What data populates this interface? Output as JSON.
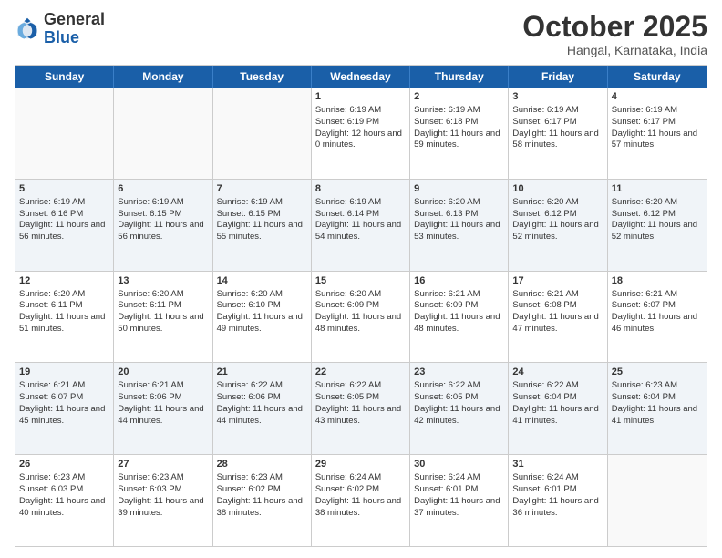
{
  "header": {
    "logo_general": "General",
    "logo_blue": "Blue",
    "month_title": "October 2025",
    "location": "Hangal, Karnataka, India"
  },
  "weekdays": [
    "Sunday",
    "Monday",
    "Tuesday",
    "Wednesday",
    "Thursday",
    "Friday",
    "Saturday"
  ],
  "rows": [
    [
      {
        "day": "",
        "sunrise": "",
        "sunset": "",
        "daylight": ""
      },
      {
        "day": "",
        "sunrise": "",
        "sunset": "",
        "daylight": ""
      },
      {
        "day": "",
        "sunrise": "",
        "sunset": "",
        "daylight": ""
      },
      {
        "day": "1",
        "sunrise": "Sunrise: 6:19 AM",
        "sunset": "Sunset: 6:19 PM",
        "daylight": "Daylight: 12 hours and 0 minutes."
      },
      {
        "day": "2",
        "sunrise": "Sunrise: 6:19 AM",
        "sunset": "Sunset: 6:18 PM",
        "daylight": "Daylight: 11 hours and 59 minutes."
      },
      {
        "day": "3",
        "sunrise": "Sunrise: 6:19 AM",
        "sunset": "Sunset: 6:17 PM",
        "daylight": "Daylight: 11 hours and 58 minutes."
      },
      {
        "day": "4",
        "sunrise": "Sunrise: 6:19 AM",
        "sunset": "Sunset: 6:17 PM",
        "daylight": "Daylight: 11 hours and 57 minutes."
      }
    ],
    [
      {
        "day": "5",
        "sunrise": "Sunrise: 6:19 AM",
        "sunset": "Sunset: 6:16 PM",
        "daylight": "Daylight: 11 hours and 56 minutes."
      },
      {
        "day": "6",
        "sunrise": "Sunrise: 6:19 AM",
        "sunset": "Sunset: 6:15 PM",
        "daylight": "Daylight: 11 hours and 56 minutes."
      },
      {
        "day": "7",
        "sunrise": "Sunrise: 6:19 AM",
        "sunset": "Sunset: 6:15 PM",
        "daylight": "Daylight: 11 hours and 55 minutes."
      },
      {
        "day": "8",
        "sunrise": "Sunrise: 6:19 AM",
        "sunset": "Sunset: 6:14 PM",
        "daylight": "Daylight: 11 hours and 54 minutes."
      },
      {
        "day": "9",
        "sunrise": "Sunrise: 6:20 AM",
        "sunset": "Sunset: 6:13 PM",
        "daylight": "Daylight: 11 hours and 53 minutes."
      },
      {
        "day": "10",
        "sunrise": "Sunrise: 6:20 AM",
        "sunset": "Sunset: 6:12 PM",
        "daylight": "Daylight: 11 hours and 52 minutes."
      },
      {
        "day": "11",
        "sunrise": "Sunrise: 6:20 AM",
        "sunset": "Sunset: 6:12 PM",
        "daylight": "Daylight: 11 hours and 52 minutes."
      }
    ],
    [
      {
        "day": "12",
        "sunrise": "Sunrise: 6:20 AM",
        "sunset": "Sunset: 6:11 PM",
        "daylight": "Daylight: 11 hours and 51 minutes."
      },
      {
        "day": "13",
        "sunrise": "Sunrise: 6:20 AM",
        "sunset": "Sunset: 6:11 PM",
        "daylight": "Daylight: 11 hours and 50 minutes."
      },
      {
        "day": "14",
        "sunrise": "Sunrise: 6:20 AM",
        "sunset": "Sunset: 6:10 PM",
        "daylight": "Daylight: 11 hours and 49 minutes."
      },
      {
        "day": "15",
        "sunrise": "Sunrise: 6:20 AM",
        "sunset": "Sunset: 6:09 PM",
        "daylight": "Daylight: 11 hours and 48 minutes."
      },
      {
        "day": "16",
        "sunrise": "Sunrise: 6:21 AM",
        "sunset": "Sunset: 6:09 PM",
        "daylight": "Daylight: 11 hours and 48 minutes."
      },
      {
        "day": "17",
        "sunrise": "Sunrise: 6:21 AM",
        "sunset": "Sunset: 6:08 PM",
        "daylight": "Daylight: 11 hours and 47 minutes."
      },
      {
        "day": "18",
        "sunrise": "Sunrise: 6:21 AM",
        "sunset": "Sunset: 6:07 PM",
        "daylight": "Daylight: 11 hours and 46 minutes."
      }
    ],
    [
      {
        "day": "19",
        "sunrise": "Sunrise: 6:21 AM",
        "sunset": "Sunset: 6:07 PM",
        "daylight": "Daylight: 11 hours and 45 minutes."
      },
      {
        "day": "20",
        "sunrise": "Sunrise: 6:21 AM",
        "sunset": "Sunset: 6:06 PM",
        "daylight": "Daylight: 11 hours and 44 minutes."
      },
      {
        "day": "21",
        "sunrise": "Sunrise: 6:22 AM",
        "sunset": "Sunset: 6:06 PM",
        "daylight": "Daylight: 11 hours and 44 minutes."
      },
      {
        "day": "22",
        "sunrise": "Sunrise: 6:22 AM",
        "sunset": "Sunset: 6:05 PM",
        "daylight": "Daylight: 11 hours and 43 minutes."
      },
      {
        "day": "23",
        "sunrise": "Sunrise: 6:22 AM",
        "sunset": "Sunset: 6:05 PM",
        "daylight": "Daylight: 11 hours and 42 minutes."
      },
      {
        "day": "24",
        "sunrise": "Sunrise: 6:22 AM",
        "sunset": "Sunset: 6:04 PM",
        "daylight": "Daylight: 11 hours and 41 minutes."
      },
      {
        "day": "25",
        "sunrise": "Sunrise: 6:23 AM",
        "sunset": "Sunset: 6:04 PM",
        "daylight": "Daylight: 11 hours and 41 minutes."
      }
    ],
    [
      {
        "day": "26",
        "sunrise": "Sunrise: 6:23 AM",
        "sunset": "Sunset: 6:03 PM",
        "daylight": "Daylight: 11 hours and 40 minutes."
      },
      {
        "day": "27",
        "sunrise": "Sunrise: 6:23 AM",
        "sunset": "Sunset: 6:03 PM",
        "daylight": "Daylight: 11 hours and 39 minutes."
      },
      {
        "day": "28",
        "sunrise": "Sunrise: 6:23 AM",
        "sunset": "Sunset: 6:02 PM",
        "daylight": "Daylight: 11 hours and 38 minutes."
      },
      {
        "day": "29",
        "sunrise": "Sunrise: 6:24 AM",
        "sunset": "Sunset: 6:02 PM",
        "daylight": "Daylight: 11 hours and 38 minutes."
      },
      {
        "day": "30",
        "sunrise": "Sunrise: 6:24 AM",
        "sunset": "Sunset: 6:01 PM",
        "daylight": "Daylight: 11 hours and 37 minutes."
      },
      {
        "day": "31",
        "sunrise": "Sunrise: 6:24 AM",
        "sunset": "Sunset: 6:01 PM",
        "daylight": "Daylight: 11 hours and 36 minutes."
      },
      {
        "day": "",
        "sunrise": "",
        "sunset": "",
        "daylight": ""
      }
    ]
  ]
}
